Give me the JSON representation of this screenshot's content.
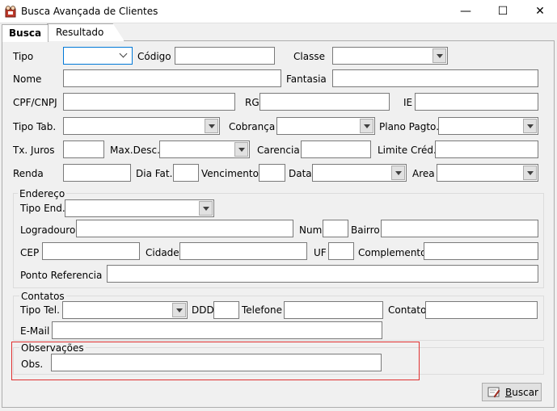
{
  "window": {
    "title": "Busca Avançada de Clientes",
    "minimize_glyph": "—",
    "maximize_glyph": "☐",
    "close_glyph": "✕"
  },
  "tabs": [
    {
      "label": "Busca",
      "active": true
    },
    {
      "label": "Resultado",
      "active": false
    }
  ],
  "fields": {
    "tipo": "Tipo",
    "codigo": "Código",
    "classe": "Classe",
    "nome": "Nome",
    "fantasia": "Fantasia",
    "cpf_cnpj": "CPF/CNPJ",
    "rg": "RG",
    "ie": "IE",
    "tipo_tab": "Tipo Tab.",
    "cobranca": "Cobrança",
    "plano_pagto": "Plano Pagto.",
    "tx_juros": "Tx. Juros",
    "max_desc": "Max.Desc.",
    "carencia": "Carencia",
    "limite_cred": "Limite Créd.",
    "renda": "Renda",
    "dia_fat": "Dia Fat.",
    "vencimento": "Vencimento",
    "data": "Data",
    "area": "Area"
  },
  "endereco": {
    "title": "Endereço",
    "tipo_end": "Tipo End.",
    "logradouro": "Logradouro",
    "num": "Num",
    "bairro": "Bairro",
    "cep": "CEP",
    "cidade": "Cidade",
    "uf": "UF",
    "complemento": "Complemento",
    "ponto_referencia": "Ponto Referencia"
  },
  "contatos": {
    "title": "Contatos",
    "tipo_tel": "Tipo Tel.",
    "ddd": "DDD",
    "telefone": "Telefone",
    "contato": "Contato",
    "email": "E-Mail"
  },
  "observacoes": {
    "title": "Observações",
    "obs": "Obs."
  },
  "buttons": {
    "buscar_underlined": "B",
    "buscar_rest": "uscar"
  },
  "colors": {
    "highlight_border": "#e03030",
    "focus_border": "#0078d7"
  }
}
